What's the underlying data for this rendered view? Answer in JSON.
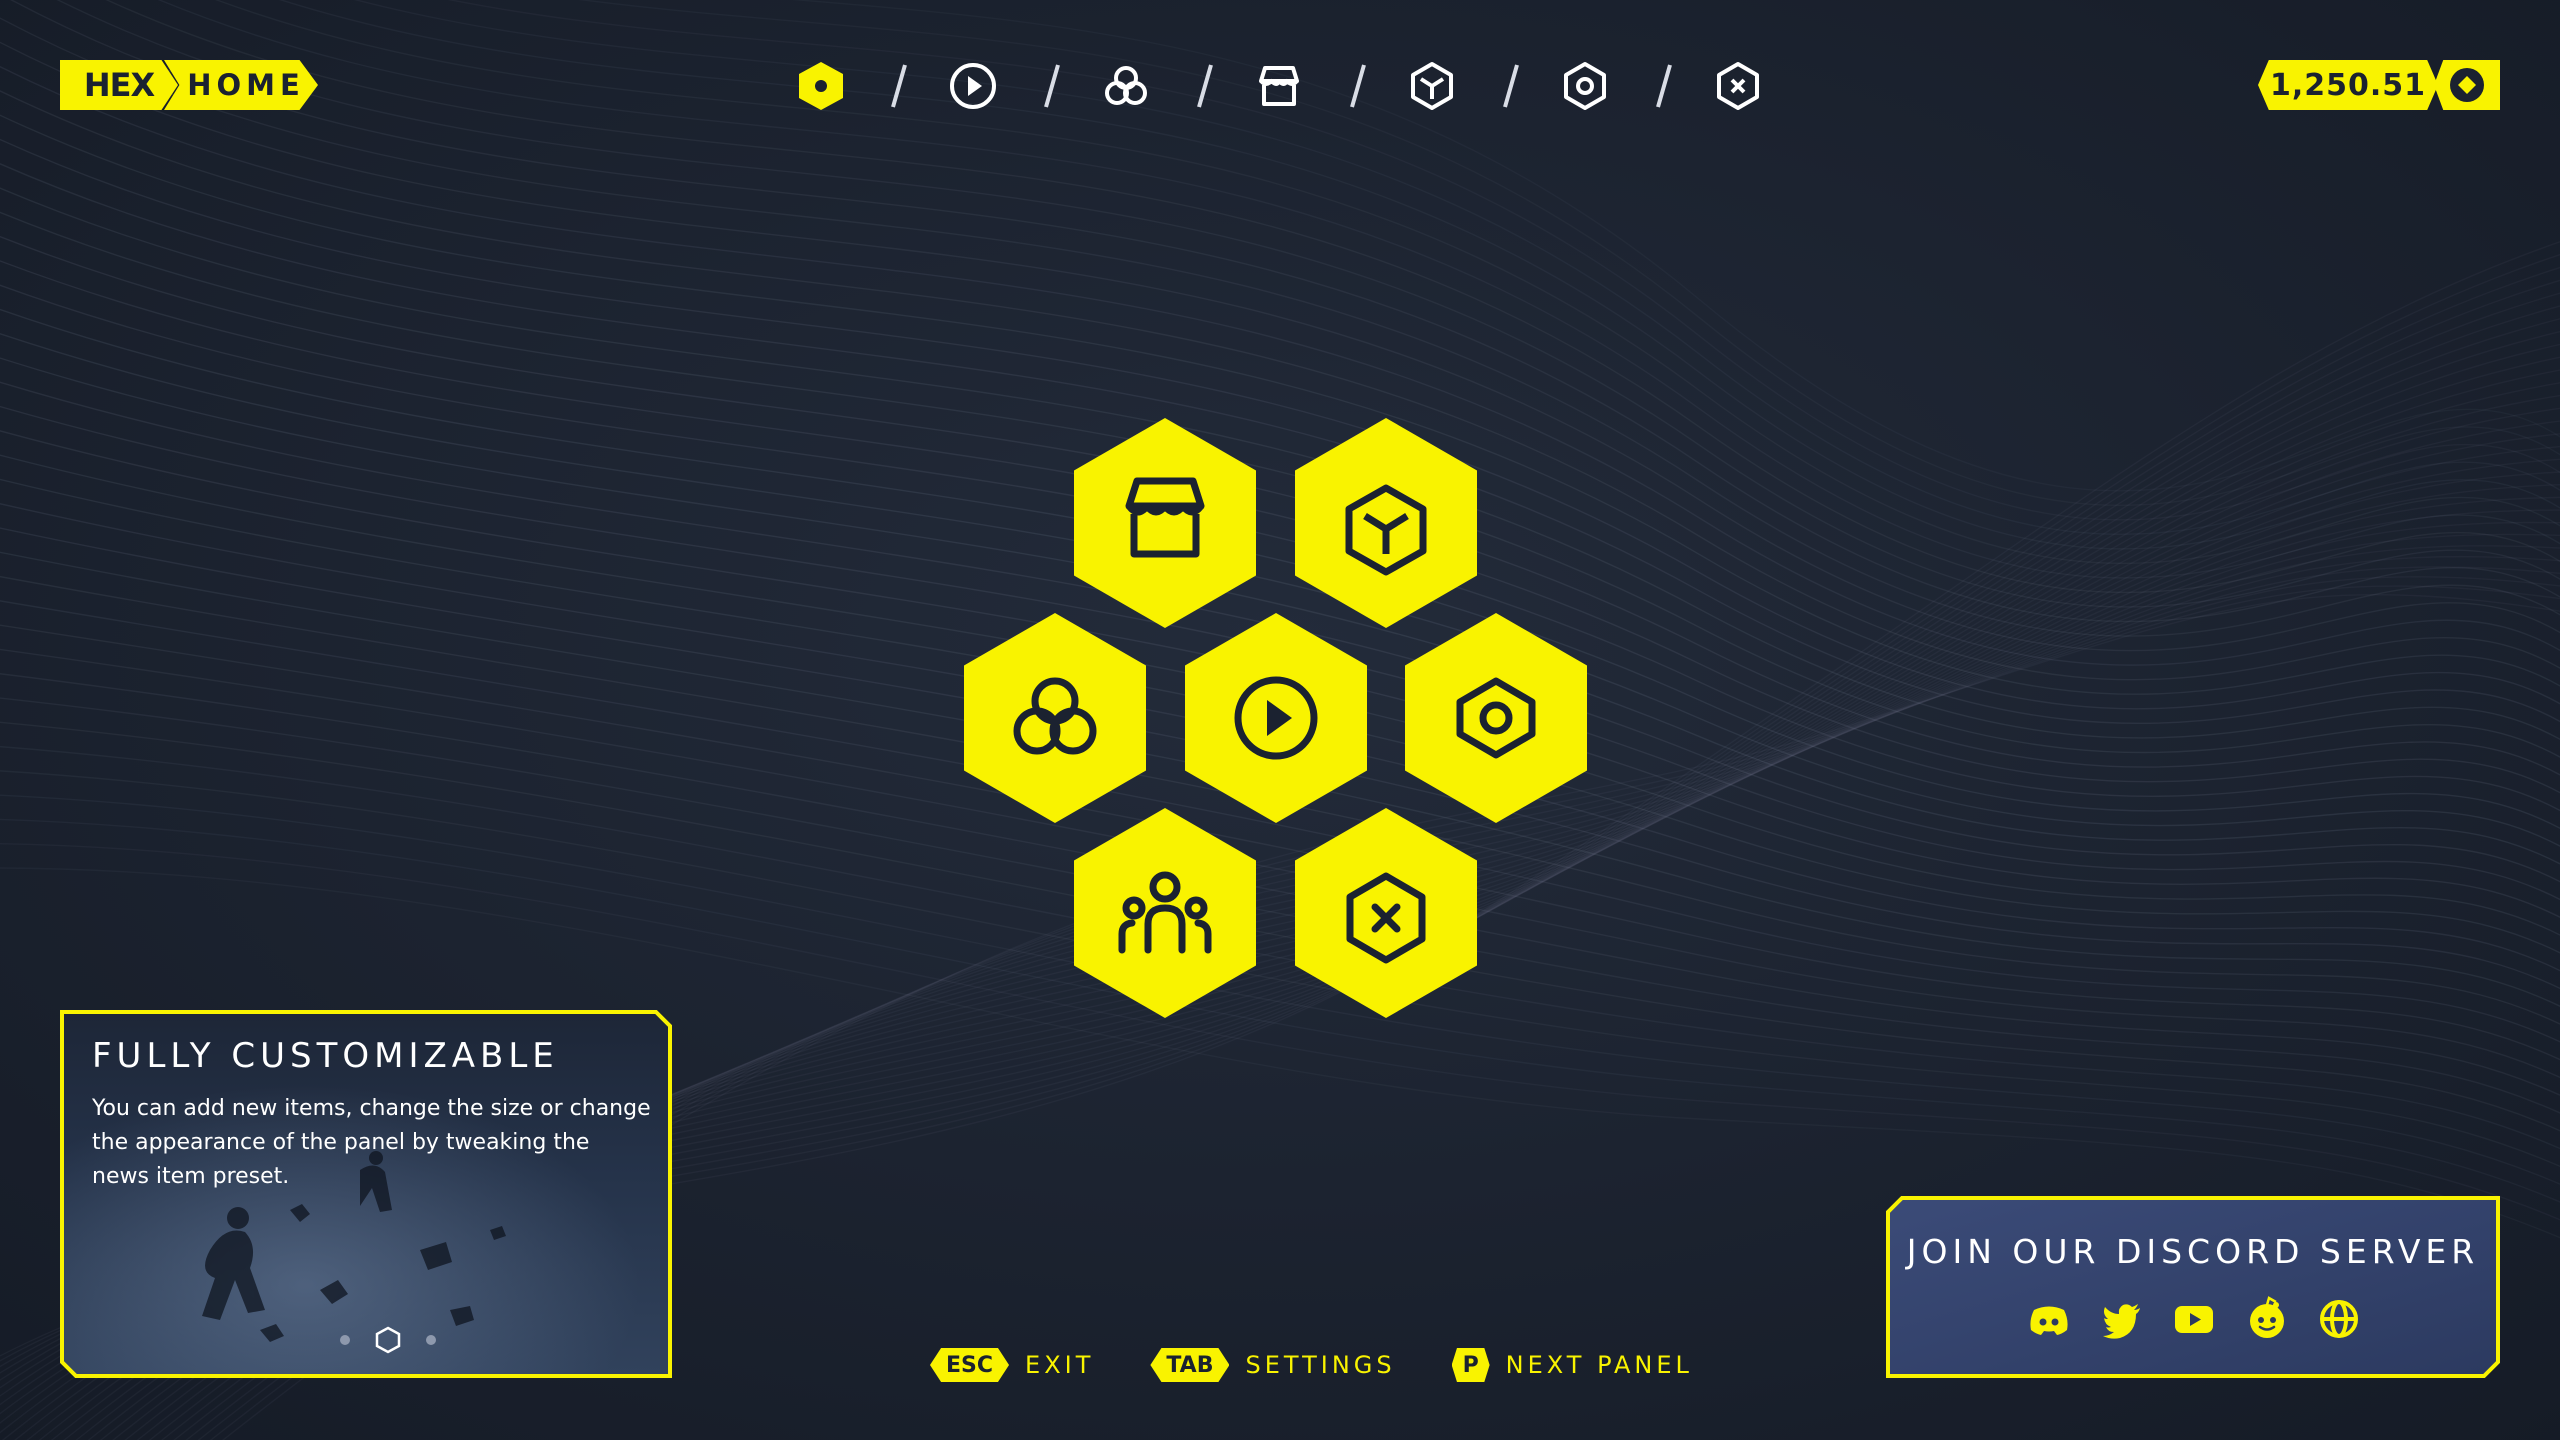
{
  "logo": {
    "brand": "HEX",
    "page": "HOME"
  },
  "colors": {
    "accent": "#f9f300",
    "background": "#1b2230",
    "icon_dark": "#1b2230"
  },
  "topnav": {
    "items": [
      {
        "icon": "home-hex-icon",
        "active": true
      },
      {
        "icon": "play-icon",
        "active": false
      },
      {
        "icon": "circles-icon",
        "active": false
      },
      {
        "icon": "store-icon",
        "active": false
      },
      {
        "icon": "cube-icon",
        "active": false
      },
      {
        "icon": "settings-hex-icon",
        "active": false
      },
      {
        "icon": "exit-icon",
        "active": false
      }
    ],
    "separator": "/"
  },
  "currency": {
    "amount": "1,250.51",
    "icon": "coin-icon"
  },
  "hex_menu": [
    {
      "icon": "store-icon"
    },
    {
      "icon": "cube-icon"
    },
    {
      "icon": "circles-icon"
    },
    {
      "icon": "play-icon"
    },
    {
      "icon": "settings-hex-icon"
    },
    {
      "icon": "friends-icon"
    },
    {
      "icon": "exit-icon"
    }
  ],
  "news": {
    "title": "FULLY CUSTOMIZABLE",
    "body": "You can add new items, change the size or change the appearance of the panel by tweaking the news item preset.",
    "pages": 3,
    "active_page": 2
  },
  "discord": {
    "title": "JOIN OUR DISCORD SERVER",
    "socials": [
      "discord-icon",
      "twitter-icon",
      "youtube-icon",
      "reddit-icon",
      "globe-icon"
    ]
  },
  "hints": [
    {
      "key": "ESC",
      "label": "EXIT"
    },
    {
      "key": "TAB",
      "label": "SETTINGS"
    },
    {
      "key": "P",
      "label": "NEXT PANEL"
    }
  ]
}
